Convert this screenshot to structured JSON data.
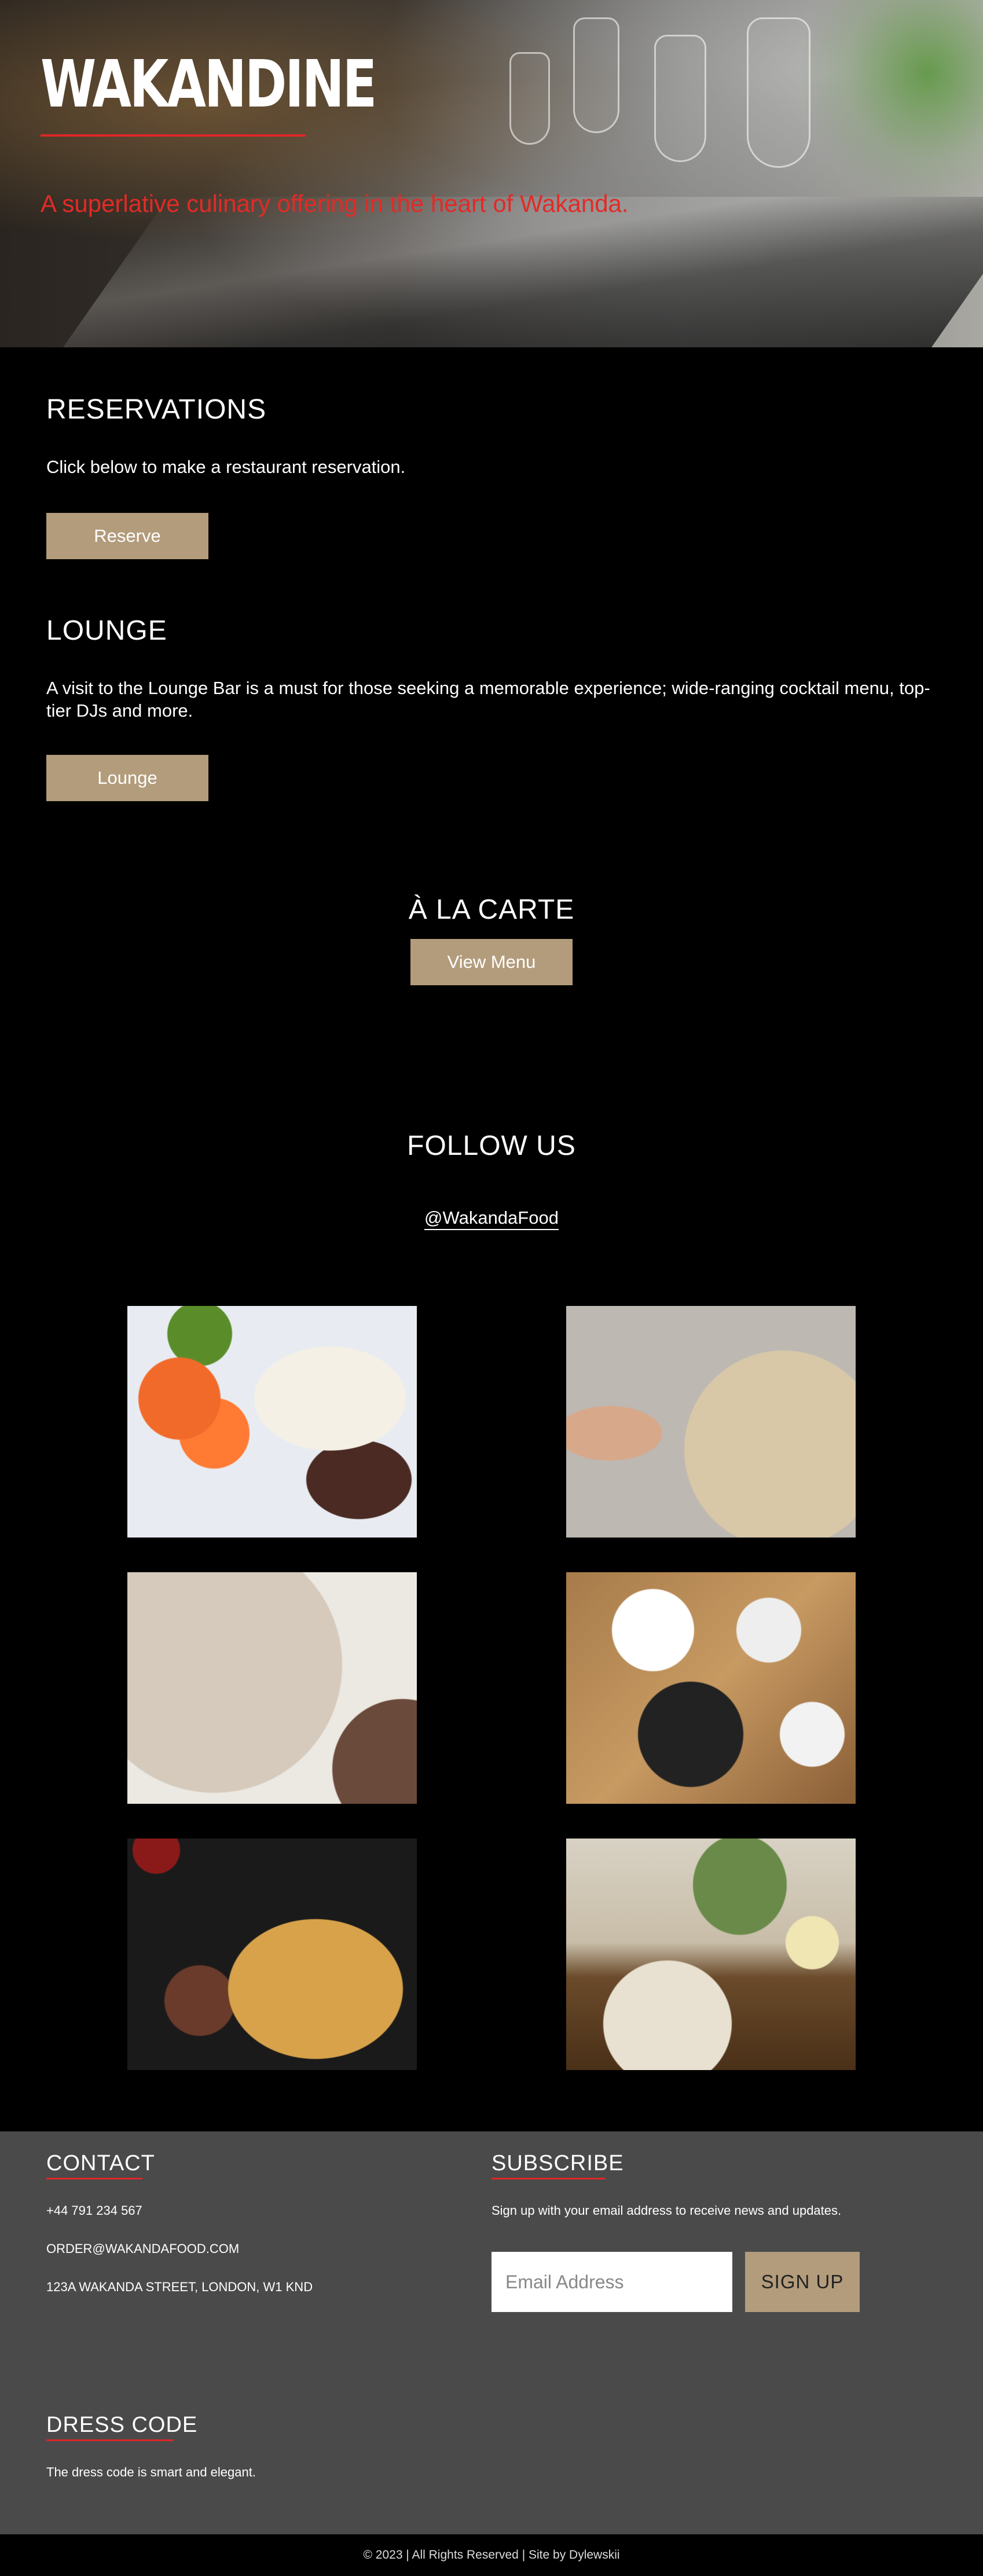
{
  "hero": {
    "logo": "WAKANDINE",
    "tagline": "A superlative culinary offering in the heart of Wakanda."
  },
  "reservations": {
    "title": "RESERVATIONS",
    "text": "Click below to make a restaurant reservation.",
    "button": "Reserve"
  },
  "lounge": {
    "title": "LOUNGE",
    "text": "A visit to the Lounge Bar is a must for those seeking a memorable experience; wide-ranging cocktail menu, top-tier DJs and more.",
    "button": "Lounge"
  },
  "menu": {
    "title": "À LA CARTE",
    "button": "View Menu"
  },
  "follow": {
    "title": "FOLLOW US",
    "handle": "@WakandaFood"
  },
  "contact": {
    "title": "CONTACT",
    "phone": "+44 791 234 567",
    "email": "ORDER@WAKANDAFOOD.COM",
    "address": "123A WAKANDA STREET, LONDON, W1 KND"
  },
  "subscribe": {
    "title": "SUBSCRIBE",
    "text": "Sign up with your email address to receive news and updates.",
    "placeholder": "Email Address",
    "button": "SIGN UP"
  },
  "dress_code": {
    "title": "DRESS CODE",
    "text": "The dress code is smart and elegant."
  },
  "footer": {
    "copyright": "© 2023 | All Rights Reserved | Site by Dylewskii"
  },
  "colors": {
    "accent": "#b39c7c",
    "red": "#e32a27",
    "footer_bg": "#4a4a4a"
  }
}
